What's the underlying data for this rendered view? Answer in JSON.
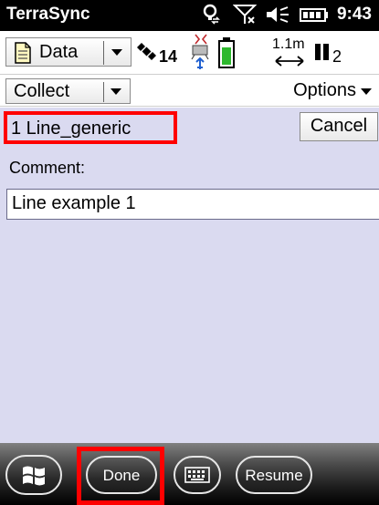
{
  "status_bar": {
    "app_title": "TerraSync",
    "time": "9:43",
    "icons": [
      "connectivity-icon",
      "signal-off-icon",
      "volume-icon",
      "battery-icon"
    ]
  },
  "toolbar": {
    "data_label": "Data",
    "satellite_count": "14",
    "accuracy": "1.1m",
    "pdop_value": "2"
  },
  "collect_row": {
    "collect_label": "Collect",
    "options_label": "Options"
  },
  "form": {
    "feature_name": "1 Line_generic",
    "cancel_label": "Cancel",
    "comment_label": "Comment:",
    "comment_value": "Line example 1"
  },
  "softkeys": {
    "done_label": "Done",
    "resume_label": "Resume"
  },
  "colors": {
    "highlight": "#ff0000",
    "form_background": "#dadaf0",
    "status_bar": "#000000"
  }
}
